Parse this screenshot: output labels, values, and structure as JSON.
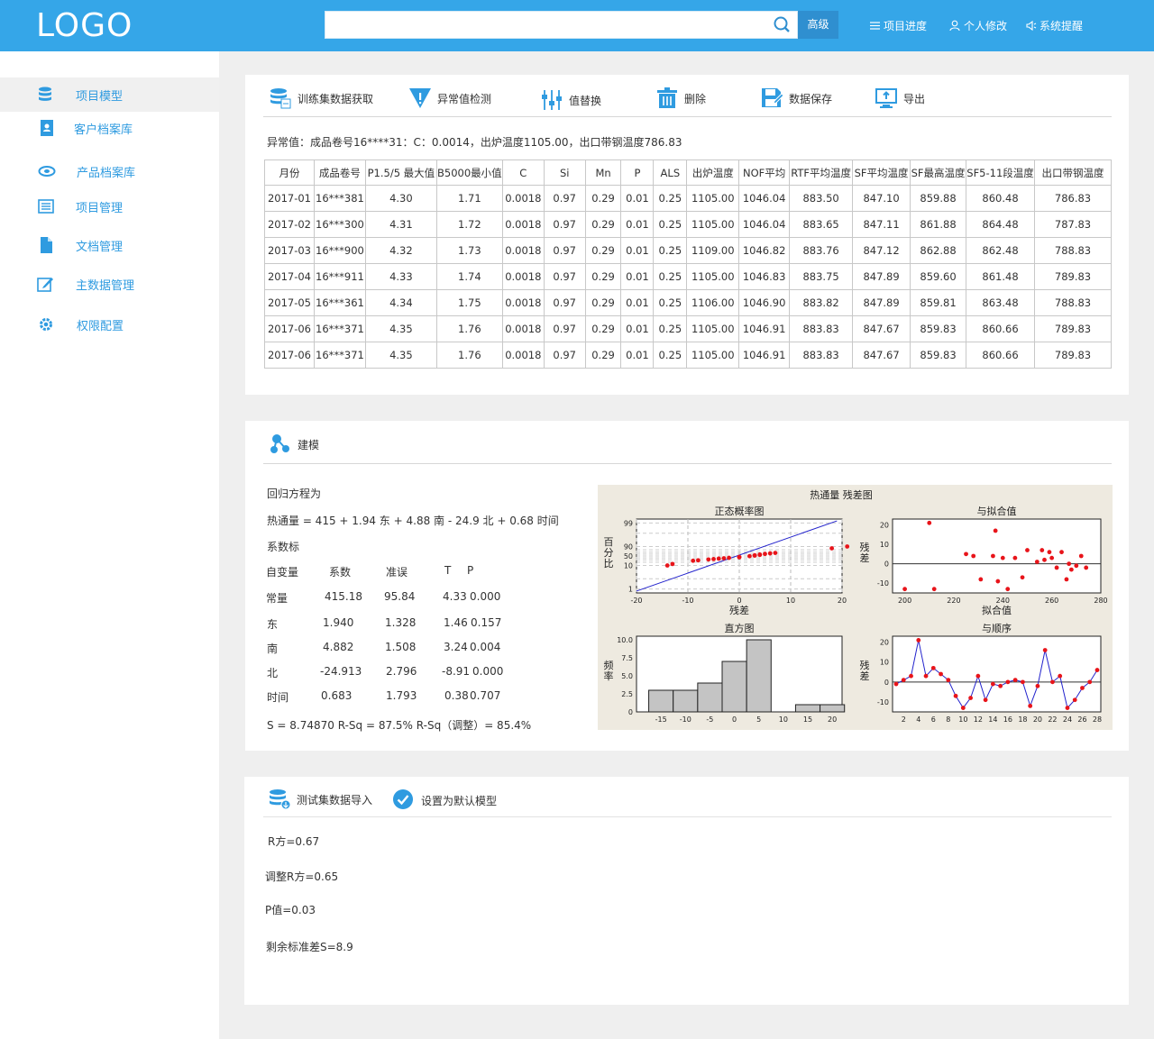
{
  "header": {
    "logo": "LOGO",
    "search_placeholder": "",
    "advanced_label": "高级",
    "nav": [
      {
        "label": "项目进度",
        "icon": "menu-icon"
      },
      {
        "label": "个人修改",
        "icon": "user-icon"
      },
      {
        "label": "系统提醒",
        "icon": "speaker-icon"
      }
    ]
  },
  "sidebar": {
    "items": [
      {
        "label": "项目模型",
        "icon": "database-icon",
        "active": true
      },
      {
        "label": "客户档案库",
        "icon": "contacts-icon"
      },
      {
        "label": "产品档案库",
        "icon": "product-icon"
      },
      {
        "label": "项目管理",
        "icon": "list-icon"
      },
      {
        "label": "文档管理",
        "icon": "document-icon"
      },
      {
        "label": "主数据管理",
        "icon": "edit-icon"
      },
      {
        "label": "权限配置",
        "icon": "gear-icon"
      }
    ]
  },
  "data_panel": {
    "toolbar": [
      {
        "label": "训练集数据获取",
        "icon": "database-import-icon"
      },
      {
        "label": "异常值检测",
        "icon": "filter-warning-icon"
      },
      {
        "label": "值替换",
        "icon": "sliders-icon"
      },
      {
        "label": "删除",
        "icon": "trash-icon"
      },
      {
        "label": "数据保存",
        "icon": "save-icon"
      },
      {
        "label": "导出",
        "icon": "monitor-export-icon"
      }
    ],
    "anomaly_text": "异常值：成品卷号16****31：C：0.0014，出炉温度1105.00，出口带钢温度786.83",
    "columns": [
      "月份",
      "成品卷号",
      "P1.5/5 最大值",
      "B5000最小值",
      "C",
      "Si",
      "Mn",
      "P",
      "ALS",
      "出炉温度",
      "NOF平均",
      "RTF平均温度",
      "SF平均温度",
      "SF最高温度",
      "SF5-11段温度",
      "出口带钢温度"
    ],
    "rows": [
      [
        "2017-01",
        "16***381",
        "4.30",
        "1.71",
        "0.0018",
        "0.97",
        "0.29",
        "0.01",
        "0.25",
        "1105.00",
        "1046.04",
        "883.50",
        "847.10",
        "859.88",
        "860.48",
        "786.83"
      ],
      [
        "2017-02",
        "16***300",
        "4.31",
        "1.72",
        "0.0018",
        "0.97",
        "0.29",
        "0.01",
        "0.25",
        "1105.00",
        "1046.04",
        "883.65",
        "847.11",
        "861.88",
        "864.48",
        "787.83"
      ],
      [
        "2017-03",
        "16***900",
        "4.32",
        "1.73",
        "0.0018",
        "0.97",
        "0.29",
        "0.01",
        "0.25",
        "1109.00",
        "1046.82",
        "883.76",
        "847.12",
        "862.88",
        "862.48",
        "788.83"
      ],
      [
        "2017-04",
        "16***911",
        "4.33",
        "1.74",
        "0.0018",
        "0.97",
        "0.29",
        "0.01",
        "0.25",
        "1105.00",
        "1046.83",
        "883.75",
        "847.89",
        "859.60",
        "861.48",
        "789.83"
      ],
      [
        "2017-05",
        "16***361",
        "4.34",
        "1.75",
        "0.0018",
        "0.97",
        "0.29",
        "0.01",
        "0.25",
        "1106.00",
        "1046.90",
        "883.82",
        "847.89",
        "859.81",
        "863.48",
        "788.83"
      ],
      [
        "2017-06",
        "16***371",
        "4.35",
        "1.76",
        "0.0018",
        "0.97",
        "0.29",
        "0.01",
        "0.25",
        "1105.00",
        "1046.91",
        "883.83",
        "847.67",
        "859.83",
        "860.66",
        "789.83"
      ],
      [
        "2017-06",
        "16***371",
        "4.35",
        "1.76",
        "0.0018",
        "0.97",
        "0.29",
        "0.01",
        "0.25",
        "1105.00",
        "1046.91",
        "883.83",
        "847.67",
        "859.83",
        "860.66",
        "789.83"
      ]
    ]
  },
  "model_panel": {
    "title": "建模",
    "title_icon": "molecule-icon",
    "regression_title": "回归方程为",
    "equation": "热通量 = 415 + 1.94 东 + 4.88 南 - 24.9 北 + 0.68   时间",
    "coef_title": "系数标",
    "coef_header": [
      "自变量",
      "系数",
      "准误",
      "T",
      "P"
    ],
    "coef_rows": [
      [
        "常量",
        "415.18",
        "95.84",
        "4.33",
        "0.000"
      ],
      [
        "东",
        "1.940",
        "1.328",
        "1.46",
        "0.157"
      ],
      [
        "南",
        "4.882",
        "1.508",
        "3.24",
        "0.004"
      ],
      [
        "北",
        "-24.913",
        "2.796",
        "-8.91",
        "0.000"
      ],
      [
        "时间",
        "0.683",
        "1.793",
        "0.38",
        "0.707"
      ]
    ],
    "summary": "S = 8.74870   R-Sq = 87.5%   R-Sq（调整）= 85.4%",
    "figure_title": "热通量   残差图"
  },
  "chart_data": [
    {
      "type": "scatter",
      "title": "正态概率图",
      "xlabel": "残差",
      "ylabel": "百分比",
      "xlim": [
        -20,
        20
      ],
      "xticks": [
        "-20",
        "-10",
        "0",
        "10",
        "20"
      ],
      "yticks": [
        "1",
        "10",
        "50",
        "90",
        "99"
      ],
      "x": [
        -14,
        -13,
        -9,
        -8,
        -6,
        -5,
        -4,
        -3,
        -2,
        0,
        0,
        2,
        3,
        3,
        4,
        4,
        5,
        6,
        7,
        18,
        21
      ],
      "y": [
        10,
        14,
        26,
        28,
        32,
        34,
        36,
        38,
        40,
        43,
        45,
        49,
        52,
        54,
        56,
        58,
        61,
        64,
        66,
        85,
        90
      ]
    },
    {
      "type": "scatter",
      "title": "与拟合值",
      "xlabel": "拟合值",
      "ylabel": "残差",
      "xlim": [
        195,
        280
      ],
      "ylim": [
        -15,
        23
      ],
      "xticks": [
        "200",
        "220",
        "240",
        "260",
        "280"
      ],
      "yticks": [
        "-10",
        "0",
        "10",
        "20"
      ],
      "x": [
        200,
        210,
        212,
        225,
        228,
        231,
        236,
        237,
        238,
        240,
        242,
        245,
        248,
        250,
        254,
        256,
        257,
        259,
        260,
        262,
        264,
        266,
        267,
        268,
        270,
        272,
        274
      ],
      "y": [
        -13,
        21,
        -13,
        5,
        4,
        -8,
        4,
        17,
        -9,
        3,
        -13,
        3,
        -7,
        7,
        1,
        7,
        2,
        6,
        3,
        -2,
        6,
        -8,
        0,
        -3,
        -1,
        4,
        -2
      ]
    },
    {
      "type": "bar",
      "title": "直方图",
      "xlabel": "",
      "ylabel": "频率",
      "xticks": [
        "-15",
        "-10",
        "-5",
        "0",
        "5",
        "10",
        "15",
        "20"
      ],
      "yticks": [
        "0",
        "2.5",
        "5.0",
        "7.5",
        "10.0"
      ],
      "bin_starts": [
        -17.5,
        -12.5,
        -7.5,
        -2.5,
        2.5,
        7.5,
        12.5,
        17.5
      ],
      "bin_width": 5,
      "values": [
        3,
        3,
        4,
        7,
        10,
        0,
        1,
        1
      ],
      "ylim": [
        0,
        10.5
      ]
    },
    {
      "type": "line",
      "title": "与顺序",
      "xlabel": "",
      "ylabel": "残差",
      "xticks": [
        "2",
        "4",
        "6",
        "8",
        "10",
        "12",
        "14",
        "16",
        "18",
        "20",
        "22",
        "24",
        "26",
        "28"
      ],
      "yticks": [
        "-10",
        "0",
        "10",
        "20"
      ],
      "ylim": [
        -15,
        23
      ],
      "x": [
        1,
        2,
        3,
        4,
        5,
        6,
        7,
        8,
        9,
        10,
        11,
        12,
        13,
        14,
        15,
        16,
        17,
        18,
        19,
        20,
        21,
        22,
        23,
        24,
        25,
        26,
        27,
        28
      ],
      "y": [
        -1,
        1,
        3,
        21,
        3,
        7,
        4,
        1,
        -7,
        -13,
        -8,
        3,
        -9,
        -1,
        -2,
        0,
        1,
        0,
        -12,
        -2,
        16,
        0,
        3,
        -13,
        -9,
        -3,
        0,
        6
      ]
    }
  ],
  "test_panel": {
    "toolbar": [
      {
        "label": "测试集数据导入",
        "icon": "database-import-icon"
      },
      {
        "label": "设置为默认模型",
        "icon": "check-circle-icon"
      }
    ],
    "metrics": [
      "R方=0.67",
      "调整R方=0.65",
      "P值=0.03",
      "剩余标准差S=8.9"
    ]
  }
}
